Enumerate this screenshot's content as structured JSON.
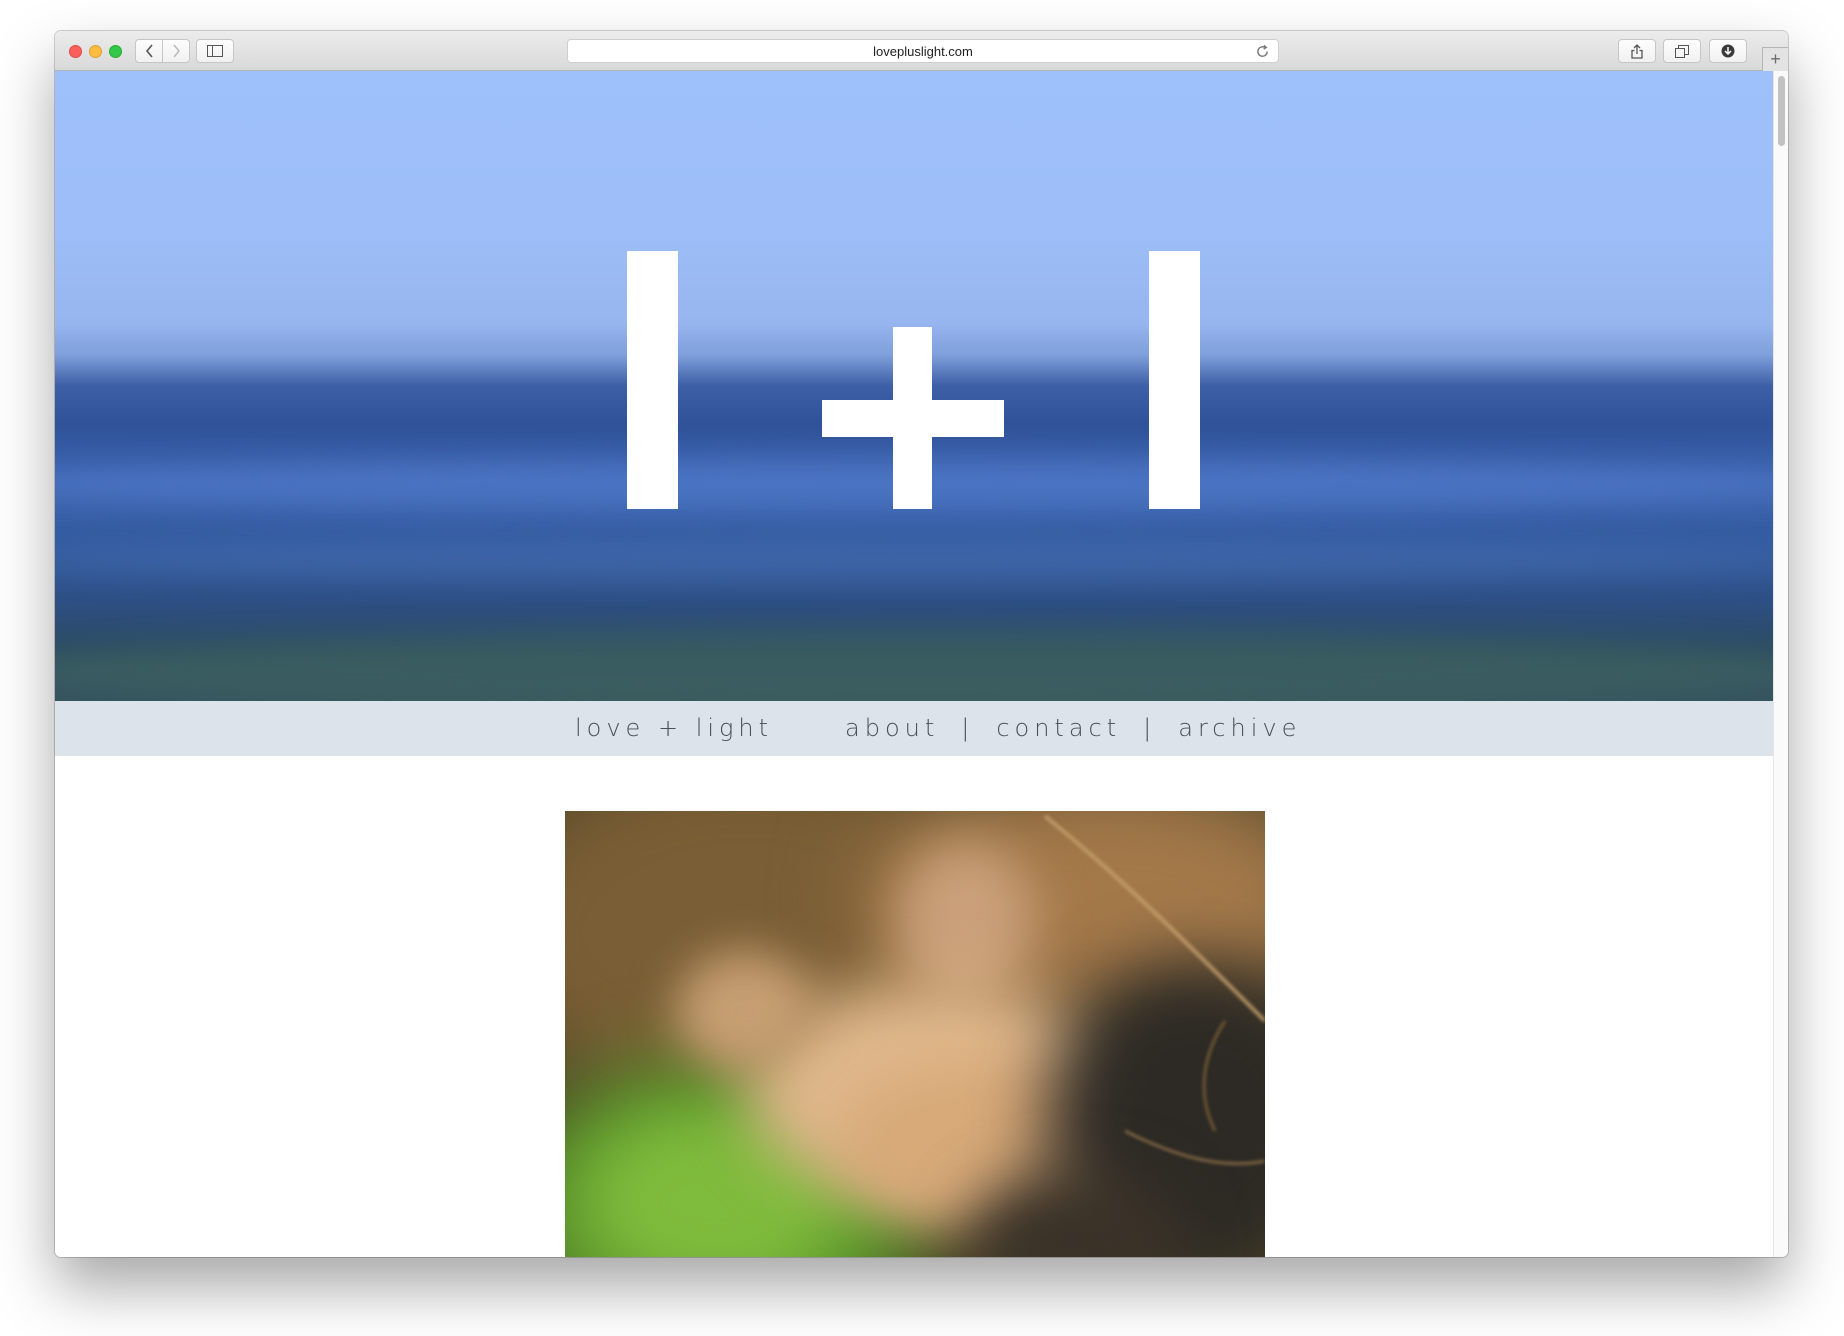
{
  "browser": {
    "url": "lovepluslight.com"
  },
  "site": {
    "logo_text": "l+l",
    "brand": "love + light",
    "nav": [
      {
        "label": "about"
      },
      {
        "label": "contact"
      },
      {
        "label": "archive"
      }
    ],
    "separator": "|"
  },
  "colors": {
    "nav_bar": "#dde3ea",
    "nav_text": "#4a4e55",
    "sky": "#9ec0fb",
    "sea": "#2f5298"
  }
}
